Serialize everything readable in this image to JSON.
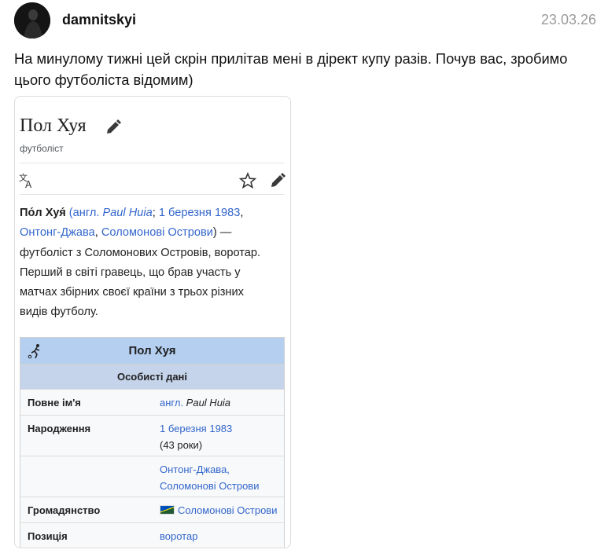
{
  "post": {
    "username": "damnitskyi",
    "date": "23.03.26",
    "text_line1": "На минулому тижні цей скрін прилітав мені в дірект купу разів. Почув вас, зробимо",
    "text_line2": "цього футболіста відомим)"
  },
  "wiki": {
    "title": "Пол Хуя",
    "description": "футболіст",
    "lead": {
      "name": "По́л Хуя́",
      "paren_open": " (",
      "lang_prefix": "англ.",
      "latin_name": " Paul Huia",
      "semicolon": "; ",
      "birth_date": "1 березня 1983",
      "comma1": ",",
      "birth_city": "Онтонг-Джава",
      "comma2": ", ",
      "birth_country": "Соломонові Острови",
      "closing": ") —",
      "line3": "футболіст з Соломонових Островів, воротар.",
      "line4": "Перший в світі гравець, що брав участь у",
      "line5": "матчах збірних своєї країни з трьох різних",
      "line6": "видів футболу."
    },
    "infobox": {
      "title": "Пол Хуя",
      "section": "Особисті дані",
      "rows": [
        {
          "key": "Повне ім'я",
          "lang": "англ.",
          "value": " Paul Huia"
        },
        {
          "key": "Народження",
          "value": "1 березня 1983",
          "value2": "(43 роки)"
        },
        {
          "key": "",
          "value": "Онтонг-Джава,",
          "value2": "Соломонові Острови"
        },
        {
          "key": "Громадянство",
          "value": "Соломонові Острови"
        },
        {
          "key": "Позиція",
          "value": "воротар"
        }
      ]
    }
  }
}
